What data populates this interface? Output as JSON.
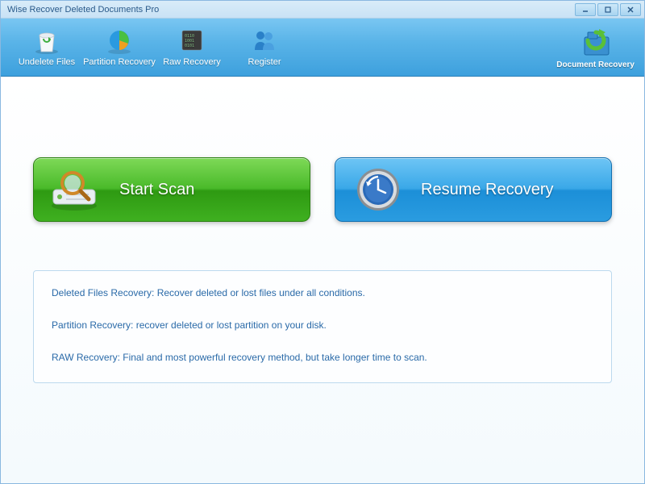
{
  "window": {
    "title": "Wise Recover Deleted Documents Pro"
  },
  "toolbar": {
    "items": [
      {
        "label": "Undelete Files"
      },
      {
        "label": "Partition Recovery"
      },
      {
        "label": "Raw Recovery"
      },
      {
        "label": "Register"
      }
    ]
  },
  "logo": {
    "text": "Document Recovery"
  },
  "actions": {
    "start_scan": "Start  Scan",
    "resume_recovery": "Resume Recovery"
  },
  "info": {
    "line1": "Deleted Files Recovery: Recover deleted or lost files  under all conditions.",
    "line2": "Partition Recovery: recover deleted or lost partition on your disk.",
    "line3": "RAW Recovery: Final and most powerful recovery method, but take longer time to scan."
  }
}
